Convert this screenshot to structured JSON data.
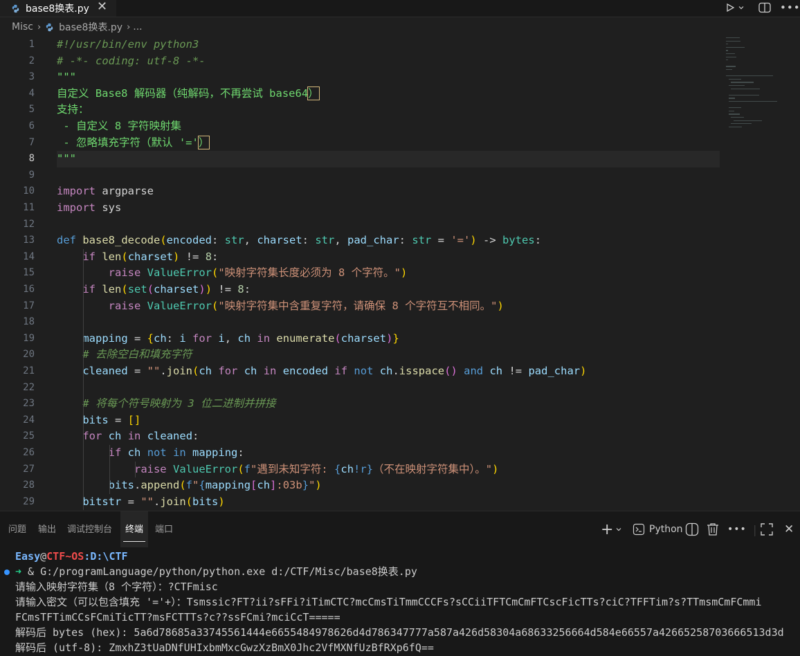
{
  "tab": {
    "filename": "base8换表.py",
    "close_glyph": "✕"
  },
  "breadcrumb": {
    "folder": "Misc",
    "file": "base8换表.py",
    "more": "..."
  },
  "editor": {
    "active_line": 8,
    "line_numbers": [
      "1",
      "2",
      "3",
      "4",
      "5",
      "6",
      "7",
      "8",
      "9",
      "10",
      "11",
      "12",
      "13",
      "14",
      "15",
      "16",
      "17",
      "18",
      "19",
      "20",
      "21",
      "22",
      "23",
      "24",
      "25",
      "26",
      "27",
      "28",
      "29"
    ],
    "lines": [
      {
        "tokens": [
          {
            "c": "cm",
            "t": "#!/usr/bin/env python3"
          }
        ]
      },
      {
        "tokens": [
          {
            "c": "cm",
            "t": "# -*- coding: utf-8 -*-"
          }
        ]
      },
      {
        "tokens": [
          {
            "c": "sg",
            "t": "\"\"\""
          }
        ]
      },
      {
        "tokens": [
          {
            "c": "sg",
            "t": "自定义 Base8 解码器（纯解码，不再尝试 base64"
          },
          {
            "c": "sg hl",
            "t": "）"
          }
        ]
      },
      {
        "tokens": [
          {
            "c": "sg",
            "t": "支持："
          }
        ]
      },
      {
        "tokens": [
          {
            "c": "sg",
            "t": " - 自定义 8 字符映射集"
          }
        ]
      },
      {
        "tokens": [
          {
            "c": "sg",
            "t": " - 忽略填充字符（默认 '='"
          },
          {
            "c": "sg hl",
            "t": "）"
          }
        ]
      },
      {
        "tokens": [
          {
            "c": "sg",
            "t": "\"\"\""
          }
        ]
      },
      {
        "tokens": []
      },
      {
        "tokens": [
          {
            "c": "kc",
            "t": "import"
          },
          {
            "c": "t",
            "t": " argparse"
          }
        ]
      },
      {
        "tokens": [
          {
            "c": "kc",
            "t": "import"
          },
          {
            "c": "t",
            "t": " sys"
          }
        ]
      },
      {
        "tokens": []
      },
      {
        "tokens": [
          {
            "c": "k",
            "t": "def"
          },
          {
            "c": "t",
            "t": " "
          },
          {
            "c": "f",
            "t": "base8_decode"
          },
          {
            "c": "br1",
            "t": "("
          },
          {
            "c": "p",
            "t": "encoded"
          },
          {
            "c": "t",
            "t": ": "
          },
          {
            "c": "c",
            "t": "str"
          },
          {
            "c": "t",
            "t": ", "
          },
          {
            "c": "p",
            "t": "charset"
          },
          {
            "c": "t",
            "t": ": "
          },
          {
            "c": "c",
            "t": "str"
          },
          {
            "c": "t",
            "t": ", "
          },
          {
            "c": "p",
            "t": "pad_char"
          },
          {
            "c": "t",
            "t": ": "
          },
          {
            "c": "c",
            "t": "str"
          },
          {
            "c": "t",
            "t": " = "
          },
          {
            "c": "s",
            "t": "'='"
          },
          {
            "c": "br1",
            "t": ")"
          },
          {
            "c": "t",
            "t": " -> "
          },
          {
            "c": "c",
            "t": "bytes"
          },
          {
            "c": "t",
            "t": ":"
          }
        ]
      },
      {
        "tokens": [
          {
            "c": "t",
            "t": "    "
          },
          {
            "c": "kc",
            "t": "if"
          },
          {
            "c": "t",
            "t": " "
          },
          {
            "c": "f",
            "t": "len"
          },
          {
            "c": "br1",
            "t": "("
          },
          {
            "c": "p",
            "t": "charset"
          },
          {
            "c": "br1",
            "t": ")"
          },
          {
            "c": "t",
            "t": " != "
          },
          {
            "c": "n",
            "t": "8"
          },
          {
            "c": "t",
            "t": ":"
          }
        ]
      },
      {
        "tokens": [
          {
            "c": "t",
            "t": "        "
          },
          {
            "c": "kc",
            "t": "raise"
          },
          {
            "c": "t",
            "t": " "
          },
          {
            "c": "c",
            "t": "ValueError"
          },
          {
            "c": "br1",
            "t": "("
          },
          {
            "c": "s",
            "t": "\"映射字符集长度必须为 8 个字符。\""
          },
          {
            "c": "br1",
            "t": ")"
          }
        ]
      },
      {
        "tokens": [
          {
            "c": "t",
            "t": "    "
          },
          {
            "c": "kc",
            "t": "if"
          },
          {
            "c": "t",
            "t": " "
          },
          {
            "c": "f",
            "t": "len"
          },
          {
            "c": "br1",
            "t": "("
          },
          {
            "c": "c",
            "t": "set"
          },
          {
            "c": "br2",
            "t": "("
          },
          {
            "c": "p",
            "t": "charset"
          },
          {
            "c": "br2",
            "t": ")"
          },
          {
            "c": "br1",
            "t": ")"
          },
          {
            "c": "t",
            "t": " != "
          },
          {
            "c": "n",
            "t": "8"
          },
          {
            "c": "t",
            "t": ":"
          }
        ]
      },
      {
        "tokens": [
          {
            "c": "t",
            "t": "        "
          },
          {
            "c": "kc",
            "t": "raise"
          },
          {
            "c": "t",
            "t": " "
          },
          {
            "c": "c",
            "t": "ValueError"
          },
          {
            "c": "br1",
            "t": "("
          },
          {
            "c": "s",
            "t": "\"映射字符集中含重复字符，请确保 8 个字符互不相同。\""
          },
          {
            "c": "br1",
            "t": ")"
          }
        ]
      },
      {
        "tokens": []
      },
      {
        "tokens": [
          {
            "c": "t",
            "t": "    "
          },
          {
            "c": "p",
            "t": "mapping"
          },
          {
            "c": "t",
            "t": " = "
          },
          {
            "c": "br1",
            "t": "{"
          },
          {
            "c": "p",
            "t": "ch"
          },
          {
            "c": "t",
            "t": ": "
          },
          {
            "c": "p",
            "t": "i"
          },
          {
            "c": "t",
            "t": " "
          },
          {
            "c": "kc",
            "t": "for"
          },
          {
            "c": "t",
            "t": " "
          },
          {
            "c": "p",
            "t": "i"
          },
          {
            "c": "t",
            "t": ", "
          },
          {
            "c": "p",
            "t": "ch"
          },
          {
            "c": "t",
            "t": " "
          },
          {
            "c": "kc",
            "t": "in"
          },
          {
            "c": "t",
            "t": " "
          },
          {
            "c": "f",
            "t": "enumerate"
          },
          {
            "c": "br2",
            "t": "("
          },
          {
            "c": "p",
            "t": "charset"
          },
          {
            "c": "br2",
            "t": ")"
          },
          {
            "c": "br1",
            "t": "}"
          }
        ]
      },
      {
        "tokens": [
          {
            "c": "t",
            "t": "    "
          },
          {
            "c": "cm",
            "t": "# 去除空白和填充字符"
          }
        ]
      },
      {
        "tokens": [
          {
            "c": "t",
            "t": "    "
          },
          {
            "c": "p",
            "t": "cleaned"
          },
          {
            "c": "t",
            "t": " = "
          },
          {
            "c": "s",
            "t": "\"\""
          },
          {
            "c": "t",
            "t": "."
          },
          {
            "c": "f",
            "t": "join"
          },
          {
            "c": "br1",
            "t": "("
          },
          {
            "c": "p",
            "t": "ch"
          },
          {
            "c": "t",
            "t": " "
          },
          {
            "c": "kc",
            "t": "for"
          },
          {
            "c": "t",
            "t": " "
          },
          {
            "c": "p",
            "t": "ch"
          },
          {
            "c": "t",
            "t": " "
          },
          {
            "c": "kc",
            "t": "in"
          },
          {
            "c": "t",
            "t": " "
          },
          {
            "c": "p",
            "t": "encoded"
          },
          {
            "c": "t",
            "t": " "
          },
          {
            "c": "kc",
            "t": "if"
          },
          {
            "c": "t",
            "t": " "
          },
          {
            "c": "k",
            "t": "not"
          },
          {
            "c": "t",
            "t": " "
          },
          {
            "c": "p",
            "t": "ch"
          },
          {
            "c": "t",
            "t": "."
          },
          {
            "c": "f",
            "t": "isspace"
          },
          {
            "c": "br2",
            "t": "()"
          },
          {
            "c": "t",
            "t": " "
          },
          {
            "c": "k",
            "t": "and"
          },
          {
            "c": "t",
            "t": " "
          },
          {
            "c": "p",
            "t": "ch"
          },
          {
            "c": "t",
            "t": " != "
          },
          {
            "c": "p",
            "t": "pad_char"
          },
          {
            "c": "br1",
            "t": ")"
          }
        ]
      },
      {
        "tokens": []
      },
      {
        "tokens": [
          {
            "c": "t",
            "t": "    "
          },
          {
            "c": "cm",
            "t": "# 将每个符号映射为 3 位二进制并拼接"
          }
        ]
      },
      {
        "tokens": [
          {
            "c": "t",
            "t": "    "
          },
          {
            "c": "p",
            "t": "bits"
          },
          {
            "c": "t",
            "t": " = "
          },
          {
            "c": "br1",
            "t": "[]"
          }
        ]
      },
      {
        "tokens": [
          {
            "c": "t",
            "t": "    "
          },
          {
            "c": "kc",
            "t": "for"
          },
          {
            "c": "t",
            "t": " "
          },
          {
            "c": "p",
            "t": "ch"
          },
          {
            "c": "t",
            "t": " "
          },
          {
            "c": "kc",
            "t": "in"
          },
          {
            "c": "t",
            "t": " "
          },
          {
            "c": "p",
            "t": "cleaned"
          },
          {
            "c": "t",
            "t": ":"
          }
        ]
      },
      {
        "tokens": [
          {
            "c": "t",
            "t": "        "
          },
          {
            "c": "kc",
            "t": "if"
          },
          {
            "c": "t",
            "t": " "
          },
          {
            "c": "p",
            "t": "ch"
          },
          {
            "c": "t",
            "t": " "
          },
          {
            "c": "k",
            "t": "not"
          },
          {
            "c": "t",
            "t": " "
          },
          {
            "c": "k",
            "t": "in"
          },
          {
            "c": "t",
            "t": " "
          },
          {
            "c": "p",
            "t": "mapping"
          },
          {
            "c": "t",
            "t": ":"
          }
        ]
      },
      {
        "tokens": [
          {
            "c": "t",
            "t": "            "
          },
          {
            "c": "kc",
            "t": "raise"
          },
          {
            "c": "t",
            "t": " "
          },
          {
            "c": "c",
            "t": "ValueError"
          },
          {
            "c": "br1",
            "t": "("
          },
          {
            "c": "k",
            "t": "f"
          },
          {
            "c": "s",
            "t": "\"遇到未知字符: "
          },
          {
            "c": "k",
            "t": "{"
          },
          {
            "c": "p",
            "t": "ch"
          },
          {
            "c": "k",
            "t": "!r}"
          },
          {
            "c": "s",
            "t": "（不在映射字符集中）。\""
          },
          {
            "c": "br1",
            "t": ")"
          }
        ]
      },
      {
        "tokens": [
          {
            "c": "t",
            "t": "        "
          },
          {
            "c": "p",
            "t": "bits"
          },
          {
            "c": "t",
            "t": "."
          },
          {
            "c": "f",
            "t": "append"
          },
          {
            "c": "br1",
            "t": "("
          },
          {
            "c": "k",
            "t": "f"
          },
          {
            "c": "s",
            "t": "\""
          },
          {
            "c": "k",
            "t": "{"
          },
          {
            "c": "p",
            "t": "mapping"
          },
          {
            "c": "br2",
            "t": "["
          },
          {
            "c": "p",
            "t": "ch"
          },
          {
            "c": "br2",
            "t": "]"
          },
          {
            "c": "s",
            "t": ":03b"
          },
          {
            "c": "k",
            "t": "}"
          },
          {
            "c": "s",
            "t": "\""
          },
          {
            "c": "br1",
            "t": ")"
          }
        ]
      },
      {
        "tokens": [
          {
            "c": "t",
            "t": "    "
          },
          {
            "c": "p",
            "t": "bitstr"
          },
          {
            "c": "t",
            "t": " = "
          },
          {
            "c": "s",
            "t": "\"\""
          },
          {
            "c": "t",
            "t": "."
          },
          {
            "c": "f",
            "t": "join"
          },
          {
            "c": "br1",
            "t": "("
          },
          {
            "c": "p",
            "t": "bits"
          },
          {
            "c": "br1",
            "t": ")"
          }
        ]
      }
    ]
  },
  "panel": {
    "tabs": [
      "问题",
      "输出",
      "调试控制台",
      "终端",
      "端口"
    ],
    "active_tab": "终端",
    "shell_label": "Python",
    "actions": {
      "add": "+",
      "more": "•••",
      "close": "✕"
    }
  },
  "terminal": {
    "prompt_user": "Easy",
    "prompt_at": "@",
    "prompt_host": "CTF~OS",
    "prompt_path": ":D:\\CTF",
    "arrow": "➜",
    "command": " & G:/programLanguage/python/python.exe d:/CTF/Misc/base8换表.py",
    "lines": [
      "请输入映射字符集（8 个字符）：?CTFmisc",
      "请输入密文（可以包含填充 '='+）：Tsmssic?FT?ii?sFFi?iTimCTC?mcCmsTiTmmCCCFs?sCCiiTFTCmCmFTCscFicTTs?ciC?TFFTim?s?TTmsmCmFCmmi",
      "FCmsTFTimCCsFCmiTicTT?msFCTTTs?c??ssFCmi?mciCcT=====",
      "解码后 bytes (hex): 5a6d78685a33745561444e6655484978626d4d786347777a587a426d58304a68633256664d584e66557a42665258703666513d3d",
      "解码后 (utf-8): ZmxhZ3tUaDNfUHIxbmMxcGwzXzBmX0Jhc2VfMXNfUzBfRXp6fQ=="
    ]
  },
  "colors": {
    "background": "#1f1f1f",
    "panel": "#181818",
    "accent": "#3794ff"
  }
}
